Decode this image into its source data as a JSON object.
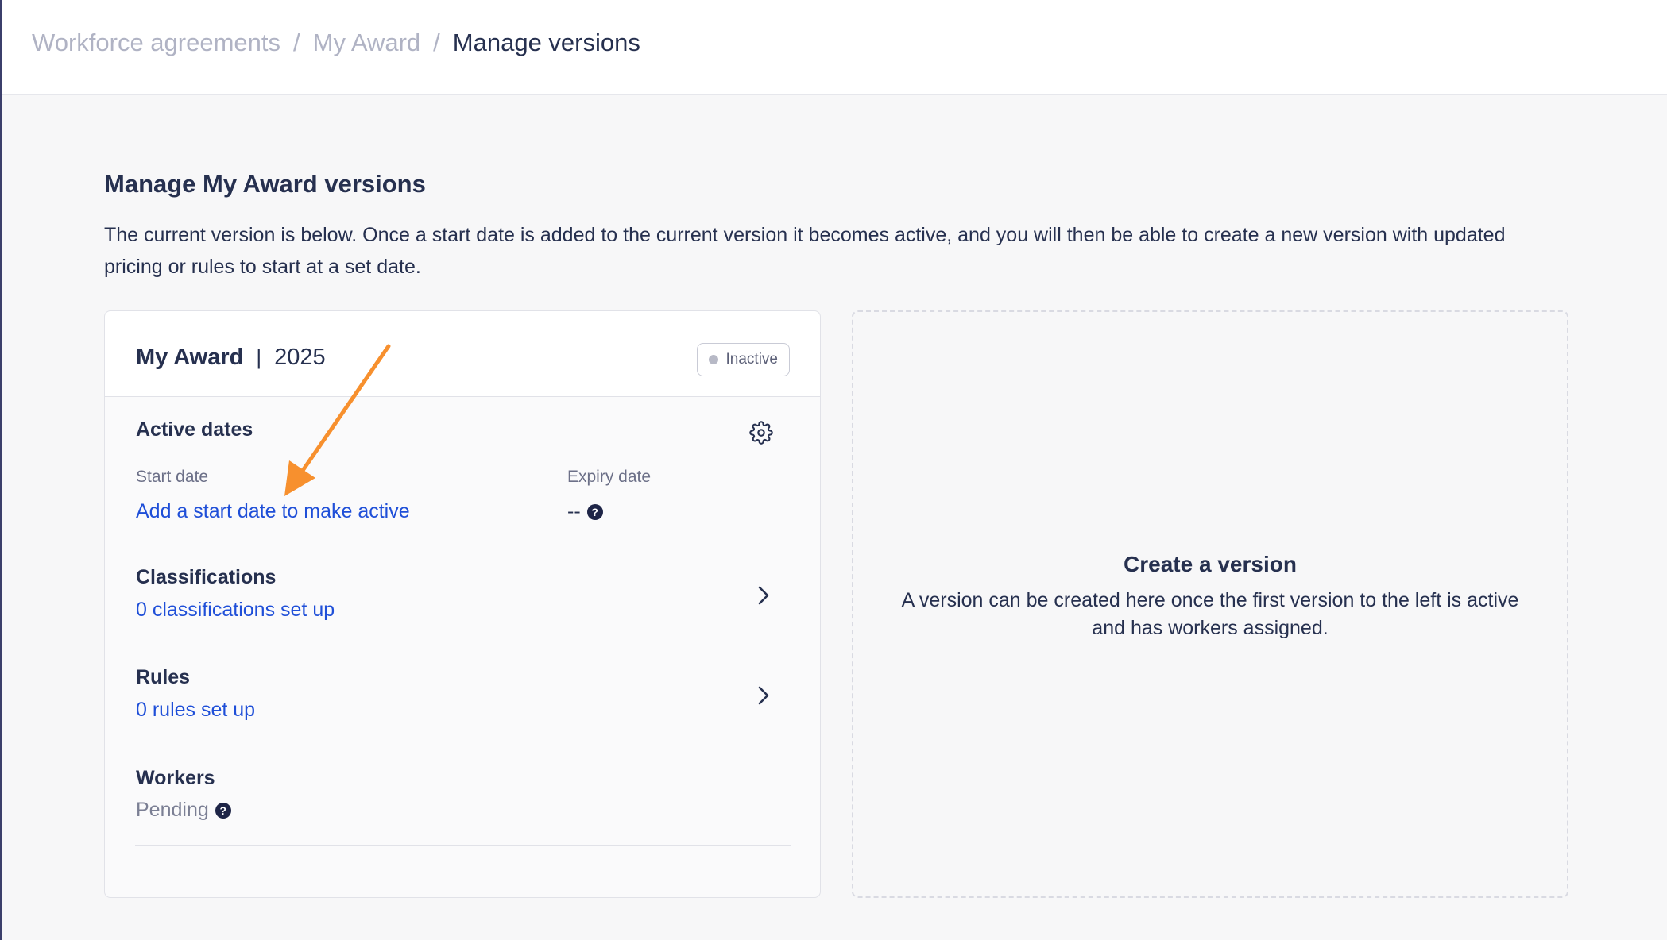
{
  "breadcrumb": {
    "items": [
      "Workforce agreements",
      "My Award"
    ],
    "current": "Manage versions",
    "separator": "/"
  },
  "page": {
    "title": "Manage My Award versions",
    "description": "The current version is below. Once a start date is added to the current version it becomes active, and you will then be able to create a new version with updated pricing or rules to start at a set date."
  },
  "version_card": {
    "name": "My Award",
    "separator": "|",
    "year": "2025",
    "status": "Inactive",
    "active_dates": {
      "heading": "Active dates",
      "start_label": "Start date",
      "start_value": "Add a start date to make active",
      "expiry_label": "Expiry date",
      "expiry_value": "--"
    },
    "classifications": {
      "heading": "Classifications",
      "value": "0 classifications set up"
    },
    "rules": {
      "heading": "Rules",
      "value": "0 rules set up"
    },
    "workers": {
      "heading": "Workers",
      "value": "Pending"
    },
    "help_glyph": "?"
  },
  "create_version": {
    "title": "Create a version",
    "description": "A version can be created here once the first version to the left is active and has workers assigned."
  },
  "icons": {
    "settings": "gear-icon",
    "chevron": "chevron-right-icon",
    "help": "question-circle-icon",
    "status": "status-dot-icon"
  },
  "colors": {
    "link": "#1f4fd8",
    "text": "#26304f",
    "muted": "#7b7f94",
    "annotation_arrow": "#f7902e"
  }
}
